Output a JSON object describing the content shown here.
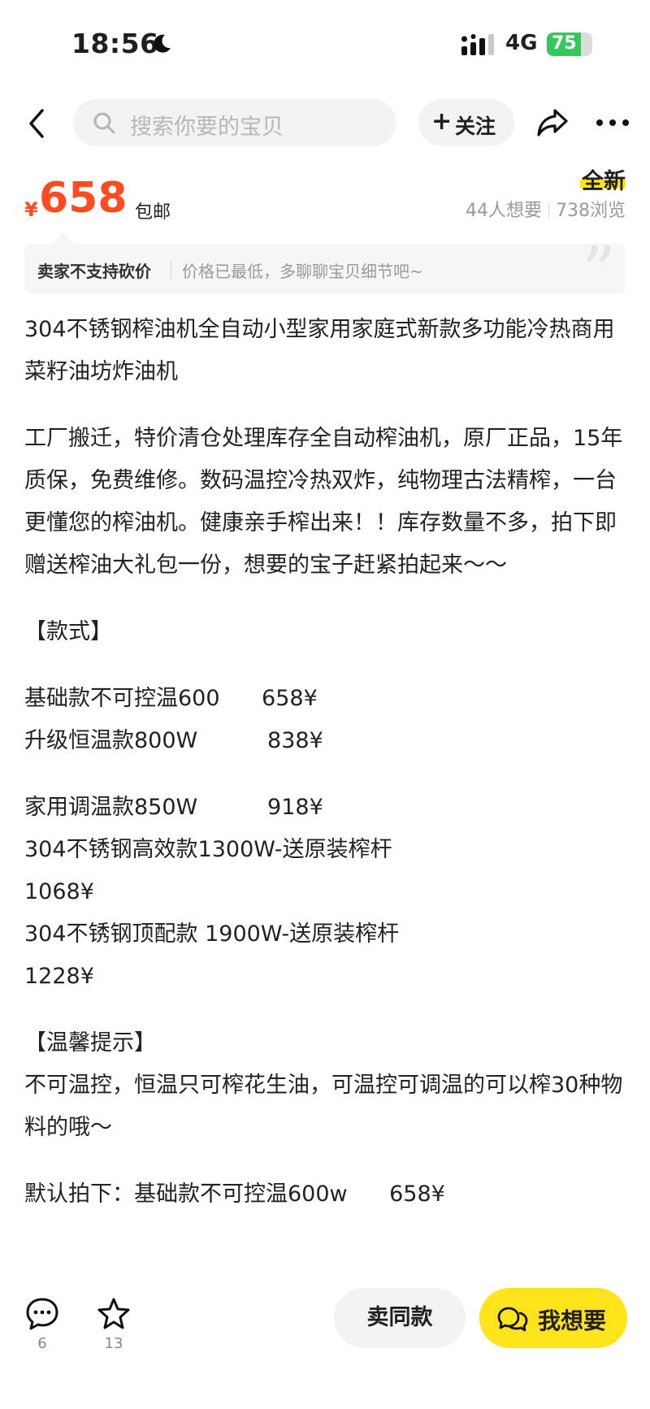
{
  "status_bar": {
    "time": "18:56",
    "network": "4G",
    "battery": "75",
    "battery_level": 0.75,
    "icons": [
      "moon-icon",
      "signal-icon",
      "battery-charging-icon"
    ]
  },
  "nav": {
    "search_placeholder": "搜索你要的宝贝",
    "follow_label": "关注",
    "icons": [
      "back-arrow-icon",
      "search-icon",
      "plus-icon",
      "share-icon",
      "more-dots-icon"
    ]
  },
  "product": {
    "currency": "¥",
    "price": "658",
    "shipping": "包邮",
    "condition": "全新",
    "wants": "44人想要",
    "views": "738浏览",
    "accent_color": "#ff4b1f",
    "highlight_color": "#ffe60f"
  },
  "bargain": {
    "main": "卖家不支持砍价",
    "sub": "价格已最低，多聊聊宝贝细节吧~"
  },
  "description": {
    "title": "304不锈钢榨油机全自动小型家用家庭式新款多功能冷热商用菜籽油坊炸油机",
    "intro": "工厂搬迁，特价清仓处理库存全自动榨油机，原厂正品，15年质保，免费维修。数码温控冷热双炸，纯物理古法精榨，一台更懂您的榨油机。健康亲手榨出来！！库存数量不多，拍下即赠送榨油大礼包一份，想要的宝子赶紧拍起来～～",
    "styles_heading": "【款式】",
    "styles_group1": [
      "基础款不可控温600      658¥",
      "升级恒温款800W          838¥"
    ],
    "styles_group2": [
      "家用调温款850W          918¥",
      "304不锈钢高效款1300W-送原装榨杆",
      "1068¥",
      "304不锈钢顶配款 1900W-送原装榨杆",
      "1228¥"
    ],
    "tips_heading": "【温馨提示】",
    "tips": "不可温控，恒温只可榨花生油，可温控可调温的可以榨30种物料的哦～",
    "default": "默认拍下：基础款不可控温600w      658¥"
  },
  "bottom_bar": {
    "comment_count": "6",
    "favorite_count": "13",
    "sell_same_label": "卖同款",
    "want_label": "我想要",
    "want_color": "#ffe31b",
    "icons": [
      "comment-icon",
      "star-icon",
      "chat-bubbles-icon"
    ]
  }
}
